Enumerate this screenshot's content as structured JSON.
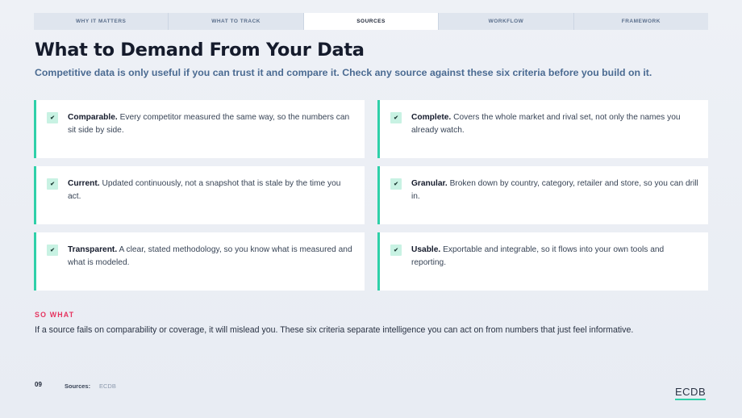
{
  "tabs": [
    {
      "label": "WHY IT MATTERS"
    },
    {
      "label": "WHAT TO TRACK"
    },
    {
      "label": "SOURCES"
    },
    {
      "label": "WORKFLOW"
    },
    {
      "label": "FRAMEWORK"
    }
  ],
  "active_tab": "SOURCES",
  "title": "What to Demand From Your Data",
  "subtitle": "Competitive data is only useful if you can trust it and compare it. Check any source against these six criteria before you build on it.",
  "criteria": [
    {
      "icon": "check-icon",
      "name": "Comparable.",
      "text": "Every competitor measured the same way, so the numbers can sit side by side."
    },
    {
      "icon": "check-icon",
      "name": "Complete.",
      "text": "Covers the whole market and rival set, not only the names you already watch."
    },
    {
      "icon": "check-icon",
      "name": "Current.",
      "text": "Updated continuously, not a snapshot that is stale by the time you act."
    },
    {
      "icon": "check-icon",
      "name": "Granular.",
      "text": "Broken down by country, category, retailer and store, so you can drill in."
    },
    {
      "icon": "check-icon",
      "name": "Transparent.",
      "text": "A clear, stated methodology, so you know what is measured and what is modeled."
    },
    {
      "icon": "check-icon",
      "name": "Usable.",
      "text": "Exportable and integrable, so it flows into your own tools and reporting."
    }
  ],
  "so_what": {
    "label": "SO WHAT",
    "text": "If a source fails on comparability or coverage, it will mislead you. These six criteria separate intelligence you can act on from numbers that just feel informative."
  },
  "footer": {
    "page_number": "09",
    "sources_label": "Sources:",
    "sources_value": "ECDB",
    "logo": "ECDB"
  },
  "colors": {
    "accent": "#2fd0a9",
    "highlight": "#e6335f",
    "subtitle": "#4b6b92"
  }
}
